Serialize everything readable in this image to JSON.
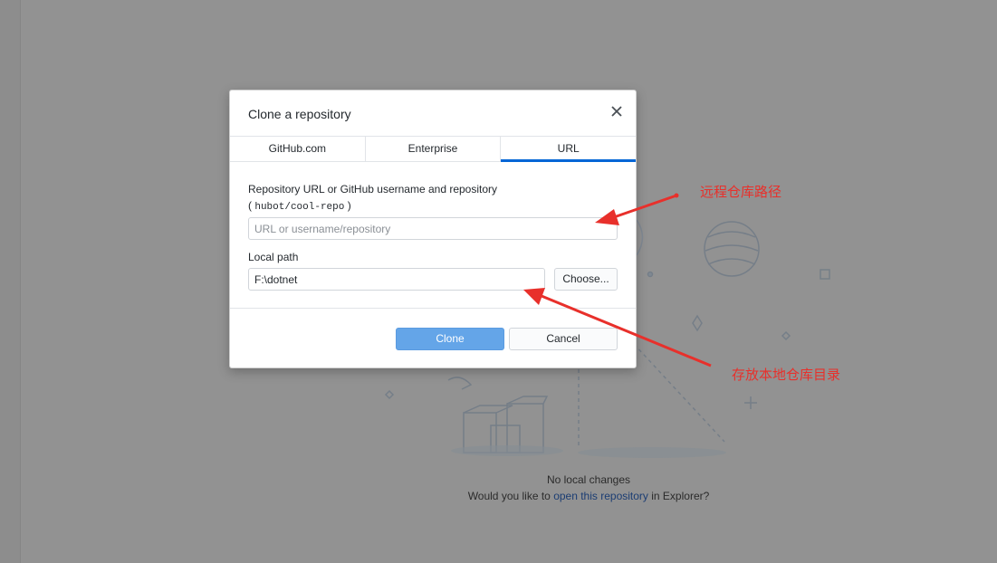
{
  "background": {
    "status_title": "No local changes",
    "prompt_prefix": "Would you like to ",
    "prompt_link": "open this repository",
    "prompt_suffix": " in Explorer?"
  },
  "dialog": {
    "title": "Clone a repository",
    "tabs": [
      {
        "label": "GitHub.com",
        "active": false
      },
      {
        "label": "Enterprise",
        "active": false
      },
      {
        "label": "URL",
        "active": true
      }
    ],
    "repo_label": "Repository URL or GitHub username and repository",
    "hint_open": "(",
    "hint_code": "hubot/cool-repo",
    "hint_close": ")",
    "repo_input": {
      "value": "",
      "placeholder": "URL or username/repository"
    },
    "local_path_label": "Local path",
    "local_path_input": {
      "value": "F:\\dotnet"
    },
    "choose_button": "Choose...",
    "clone_button": "Clone",
    "cancel_button": "Cancel"
  },
  "annotations": {
    "remote_path_note": "远程仓库路径",
    "local_dir_note": "存放本地仓库目录",
    "color": "#e8302b"
  },
  "colors": {
    "accent": "#0366d6",
    "primary_button": "#64a5e8",
    "overlay": "#929292"
  },
  "icons": [
    "close-icon",
    "arrow-icon"
  ]
}
